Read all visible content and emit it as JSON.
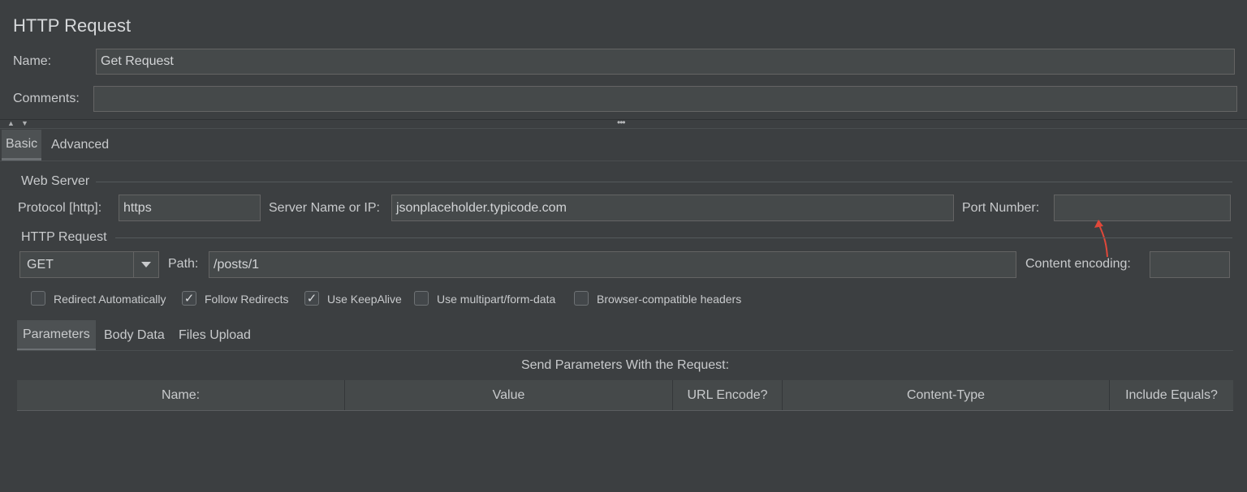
{
  "panel": {
    "title": "HTTP Request",
    "name_label": "Name:",
    "name_value": "Get  Request",
    "comments_label": "Comments:",
    "comments_value": ""
  },
  "collapse_icons": [
    "up-arrow-icon",
    "down-arrow-icon"
  ],
  "splitter_handle": "•••",
  "tabs": {
    "items": [
      {
        "label": "Basic",
        "active": true
      },
      {
        "label": "Advanced",
        "active": false
      }
    ]
  },
  "web_server": {
    "group_label": "Web Server",
    "protocol_label": "Protocol [http]:",
    "protocol_value": "https",
    "server_label": "Server Name or IP:",
    "server_value": "jsonplaceholder.typicode.com",
    "port_label": "Port Number:",
    "port_value": ""
  },
  "http_request": {
    "group_label": "HTTP Request",
    "method_value": "GET",
    "method_icon": "chevron-down-icon",
    "path_label": "Path:",
    "path_value": "/posts/1",
    "encoding_label": "Content encoding:",
    "encoding_value": ""
  },
  "options": [
    {
      "label": "Redirect Automatically",
      "checked": false
    },
    {
      "label": "Follow Redirects",
      "checked": true
    },
    {
      "label": "Use KeepAlive",
      "checked": true
    },
    {
      "label": "Use multipart/form-data",
      "checked": false
    },
    {
      "label": "Browser-compatible headers",
      "checked": false
    }
  ],
  "check_glyph": "✓",
  "subtabs": [
    {
      "label": "Parameters",
      "active": true
    },
    {
      "label": "Body Data",
      "active": false
    },
    {
      "label": "Files Upload",
      "active": false
    }
  ],
  "params": {
    "caption": "Send Parameters With the Request:",
    "columns": [
      "Name:",
      "Value",
      "URL Encode?",
      "Content-Type",
      "Include Equals?"
    ]
  },
  "annotation": {
    "color": "#e0483a",
    "icon": "red-arrow-annotation"
  },
  "colors": {
    "background": "#3c3f41",
    "field": "#45494a",
    "border": "#646464"
  }
}
